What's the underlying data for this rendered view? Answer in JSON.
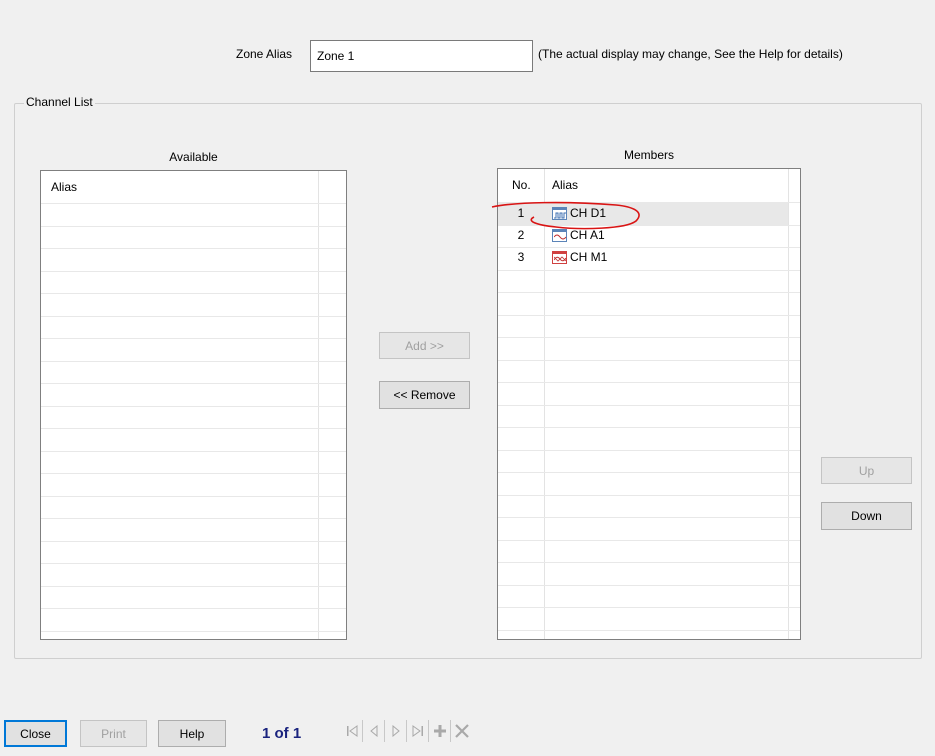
{
  "zone": {
    "label": "Zone Alias",
    "value": "Zone 1",
    "note": "(The actual display may change, See the Help for details)"
  },
  "channel_list": {
    "title": "Channel List",
    "available": {
      "title": "Available",
      "alias_header": "Alias"
    },
    "members": {
      "title": "Members",
      "no_header": "No.",
      "alias_header": "Alias",
      "rows": [
        {
          "no": "1",
          "alias": "CH D1",
          "icon": "digital-channel-icon",
          "selected": true
        },
        {
          "no": "2",
          "alias": "CH A1",
          "icon": "analog-channel-icon",
          "selected": false
        },
        {
          "no": "3",
          "alias": "CH M1",
          "icon": "math-channel-icon",
          "selected": false
        }
      ]
    },
    "buttons": {
      "add": "Add >>",
      "remove": "<< Remove",
      "up": "Up",
      "down": "Down"
    }
  },
  "footer": {
    "close": "Close",
    "print": "Print",
    "help": "Help",
    "page": "1 of 1",
    "nav_icons": [
      "first-page-icon",
      "prev-page-icon",
      "next-page-icon",
      "last-page-icon",
      "add-icon",
      "delete-icon"
    ]
  },
  "colors": {
    "accent": "#0078d7",
    "page_indicator": "#1a237e",
    "annotation": "#d91414"
  }
}
